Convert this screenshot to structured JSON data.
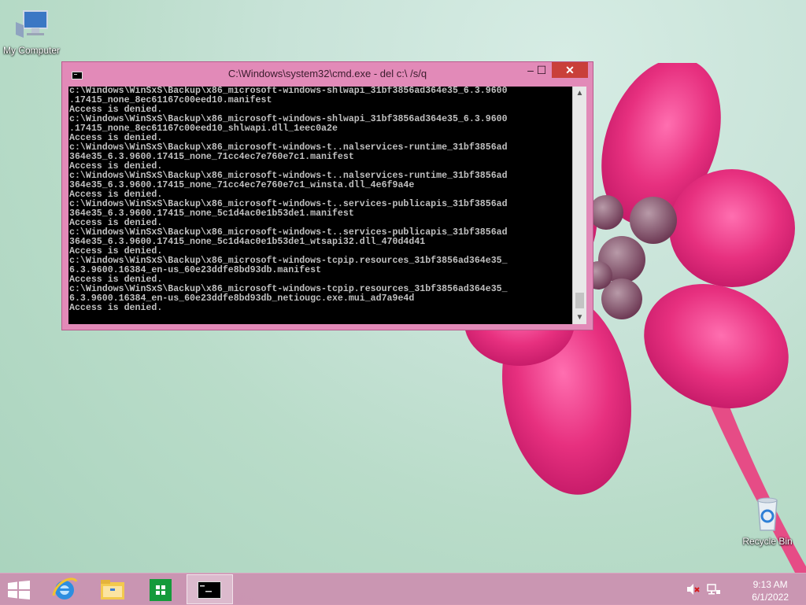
{
  "desktop": {
    "icons": [
      {
        "label": "My Computer"
      },
      {
        "label": "Recycle Bin"
      }
    ]
  },
  "window": {
    "title": "C:\\Windows\\system32\\cmd.exe - del  c:\\ /s/q",
    "minimize": "–",
    "maximize": "☐",
    "close": "✕"
  },
  "console": {
    "lines": [
      "c:\\Windows\\WinSxS\\Backup\\x86_microsoft-windows-shlwapi_31bf3856ad364e35_6.3.9600",
      ".17415_none_8ec61167c00eed10.manifest",
      "Access is denied.",
      "c:\\Windows\\WinSxS\\Backup\\x86_microsoft-windows-shlwapi_31bf3856ad364e35_6.3.9600",
      ".17415_none_8ec61167c00eed10_shlwapi.dll_1eec0a2e",
      "Access is denied.",
      "c:\\Windows\\WinSxS\\Backup\\x86_microsoft-windows-t..nalservices-runtime_31bf3856ad",
      "364e35_6.3.9600.17415_none_71cc4ec7e760e7c1.manifest",
      "Access is denied.",
      "c:\\Windows\\WinSxS\\Backup\\x86_microsoft-windows-t..nalservices-runtime_31bf3856ad",
      "364e35_6.3.9600.17415_none_71cc4ec7e760e7c1_winsta.dll_4e6f9a4e",
      "Access is denied.",
      "c:\\Windows\\WinSxS\\Backup\\x86_microsoft-windows-t..services-publicapis_31bf3856ad",
      "364e35_6.3.9600.17415_none_5c1d4ac0e1b53de1.manifest",
      "Access is denied.",
      "c:\\Windows\\WinSxS\\Backup\\x86_microsoft-windows-t..services-publicapis_31bf3856ad",
      "364e35_6.3.9600.17415_none_5c1d4ac0e1b53de1_wtsapi32.dll_470d4d41",
      "Access is denied.",
      "c:\\Windows\\WinSxS\\Backup\\x86_microsoft-windows-tcpip.resources_31bf3856ad364e35_",
      "6.3.9600.16384_en-us_60e23ddfe8bd93db.manifest",
      "Access is denied.",
      "c:\\Windows\\WinSxS\\Backup\\x86_microsoft-windows-tcpip.resources_31bf3856ad364e35_",
      "6.3.9600.16384_en-us_60e23ddfe8bd93db_netiougc.exe.mui_ad7a9e4d",
      "Access is denied."
    ]
  },
  "taskbar": {
    "apps": [
      "internet-explorer-icon",
      "file-explorer-icon",
      "store-icon",
      "cmd-icon"
    ],
    "clock": {
      "time": "9:13 AM",
      "date": "6/1/2022"
    }
  },
  "colors": {
    "window_frame": "#e28ab8",
    "close_button": "#c9403a",
    "console_bg": "#000000",
    "console_text": "#c0c0c0"
  }
}
